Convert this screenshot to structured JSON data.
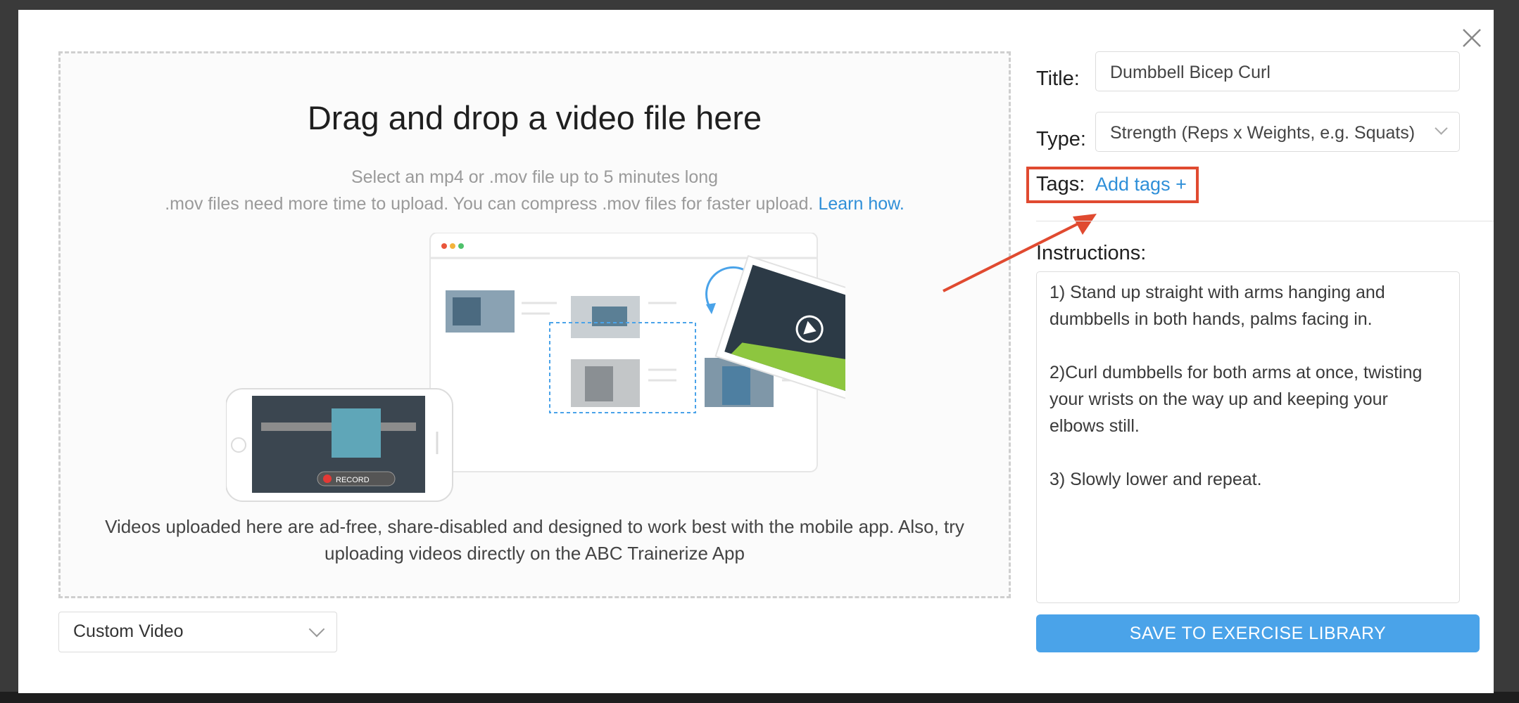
{
  "dropzone": {
    "title": "Drag and drop a video file here",
    "subtitle_line1": "Select an mp4 or .mov file up to 5 minutes long",
    "subtitle_line2": ".mov files need more time to upload. You can compress .mov files for faster upload.",
    "learn_link": "Learn how",
    "learn_suffix": ".",
    "record_label": "RECORD",
    "note": "Videos uploaded here are ad-free, share-disabled and designed to work best with the mobile app. Also, try uploading videos directly on the ABC Trainerize App"
  },
  "source_select": {
    "value": "Custom Video"
  },
  "form": {
    "title_label": "Title:",
    "title_value": "Dumbbell Bicep Curl",
    "type_label": "Type:",
    "type_value": "Strength (Reps x Weights, e.g. Squats)",
    "tags_label": "Tags:",
    "tags_link": "Add tags +",
    "instructions_label": "Instructions:",
    "instructions_value": "1) Stand up straight with arms hanging and dumbbells in both hands, palms facing in.\n\n2)Curl dumbbells for both arms at once, twisting your wrists on the way up and keeping your elbows still.\n\n3) Slowly lower and repeat.",
    "save_label": "SAVE TO EXERCISE LIBRARY"
  },
  "colors": {
    "accent": "#4aa3e9",
    "link": "#2f8fd8",
    "annotation": "#e04a30"
  },
  "icons": {
    "close": "close-icon",
    "chevron": "chevron-down-icon",
    "play": "play-icon",
    "record": "record-icon",
    "refresh": "refresh-arrow-icon"
  }
}
